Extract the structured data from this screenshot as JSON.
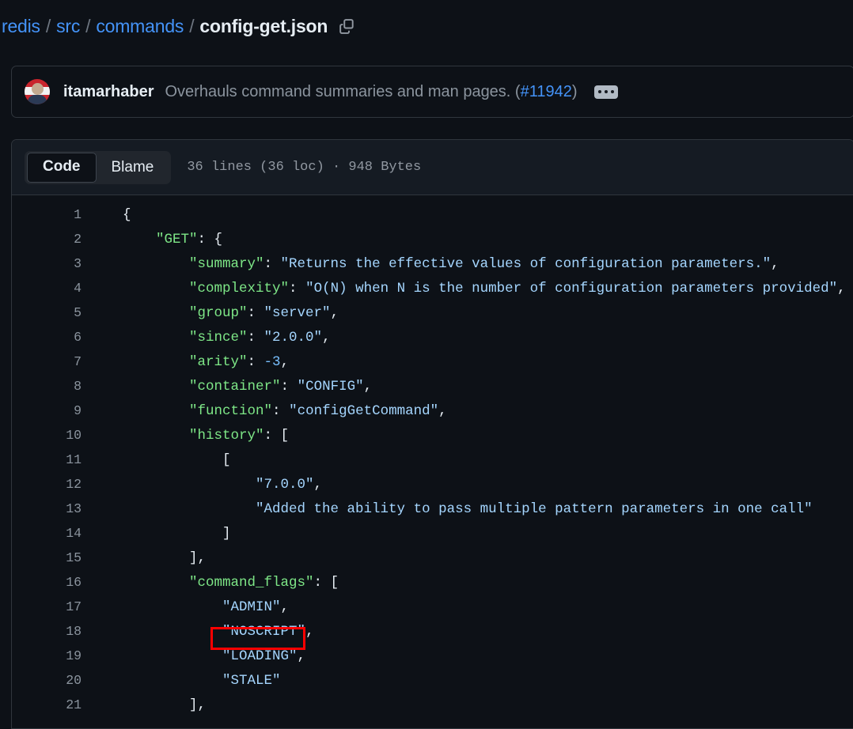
{
  "breadcrumb": {
    "repo": "redis",
    "sep": "/",
    "dir1": "src",
    "dir2": "commands",
    "file": "config-get.json",
    "copy_icon": "copy-path-icon"
  },
  "commit": {
    "author": "itamarhaber",
    "message": "Overhauls command summaries and man pages. (",
    "pr": "#11942",
    "message_end": ")",
    "menu_icon": "kebab-menu-icon"
  },
  "file_header": {
    "tab_code": "Code",
    "tab_blame": "Blame",
    "meta": "36 lines (36 loc) · 948 Bytes"
  },
  "code": {
    "lines": [
      {
        "n": "1",
        "segments": [
          {
            "t": "{",
            "c": "punct",
            "indent": 0
          }
        ]
      },
      {
        "n": "2",
        "segments": [
          {
            "t": "\"GET\"",
            "c": "key",
            "indent": 4
          },
          {
            "t": ": {",
            "c": "punct"
          }
        ]
      },
      {
        "n": "3",
        "segments": [
          {
            "t": "\"summary\"",
            "c": "key",
            "indent": 8
          },
          {
            "t": ": ",
            "c": "punct"
          },
          {
            "t": "\"Returns the effective values of configuration parameters.\"",
            "c": "str"
          },
          {
            "t": ",",
            "c": "punct"
          }
        ]
      },
      {
        "n": "4",
        "segments": [
          {
            "t": "\"complexity\"",
            "c": "key",
            "indent": 8
          },
          {
            "t": ": ",
            "c": "punct"
          },
          {
            "t": "\"O(N) when N is the number of configuration parameters provided\"",
            "c": "str"
          },
          {
            "t": ",",
            "c": "punct"
          }
        ]
      },
      {
        "n": "5",
        "segments": [
          {
            "t": "\"group\"",
            "c": "key",
            "indent": 8
          },
          {
            "t": ": ",
            "c": "punct"
          },
          {
            "t": "\"server\"",
            "c": "str"
          },
          {
            "t": ",",
            "c": "punct"
          }
        ]
      },
      {
        "n": "6",
        "segments": [
          {
            "t": "\"since\"",
            "c": "key",
            "indent": 8
          },
          {
            "t": ": ",
            "c": "punct"
          },
          {
            "t": "\"2.0.0\"",
            "c": "str"
          },
          {
            "t": ",",
            "c": "punct"
          }
        ]
      },
      {
        "n": "7",
        "segments": [
          {
            "t": "\"arity\"",
            "c": "key",
            "indent": 8
          },
          {
            "t": ": ",
            "c": "punct"
          },
          {
            "t": "-3",
            "c": "num"
          },
          {
            "t": ",",
            "c": "punct"
          }
        ]
      },
      {
        "n": "8",
        "segments": [
          {
            "t": "\"container\"",
            "c": "key",
            "indent": 8
          },
          {
            "t": ": ",
            "c": "punct"
          },
          {
            "t": "\"CONFIG\"",
            "c": "str"
          },
          {
            "t": ",",
            "c": "punct"
          }
        ]
      },
      {
        "n": "9",
        "segments": [
          {
            "t": "\"function\"",
            "c": "key",
            "indent": 8
          },
          {
            "t": ": ",
            "c": "punct"
          },
          {
            "t": "\"configGetCommand\"",
            "c": "str"
          },
          {
            "t": ",",
            "c": "punct"
          }
        ]
      },
      {
        "n": "10",
        "segments": [
          {
            "t": "\"history\"",
            "c": "key",
            "indent": 8
          },
          {
            "t": ": [",
            "c": "punct"
          }
        ]
      },
      {
        "n": "11",
        "segments": [
          {
            "t": "[",
            "c": "punct",
            "indent": 12
          }
        ]
      },
      {
        "n": "12",
        "segments": [
          {
            "t": "\"7.0.0\"",
            "c": "str",
            "indent": 16
          },
          {
            "t": ",",
            "c": "punct"
          }
        ]
      },
      {
        "n": "13",
        "segments": [
          {
            "t": "\"Added the ability to pass multiple pattern parameters in one call\"",
            "c": "str",
            "indent": 16
          }
        ]
      },
      {
        "n": "14",
        "segments": [
          {
            "t": "]",
            "c": "punct",
            "indent": 12
          }
        ]
      },
      {
        "n": "15",
        "segments": [
          {
            "t": "],",
            "c": "punct",
            "indent": 8
          }
        ]
      },
      {
        "n": "16",
        "segments": [
          {
            "t": "\"command_flags\"",
            "c": "key",
            "indent": 8
          },
          {
            "t": ": [",
            "c": "punct"
          }
        ]
      },
      {
        "n": "17",
        "segments": [
          {
            "t": "\"ADMIN\"",
            "c": "str",
            "indent": 12
          },
          {
            "t": ",",
            "c": "punct"
          }
        ]
      },
      {
        "n": "18",
        "segments": [
          {
            "t": "\"NOSCRIPT\"",
            "c": "str",
            "indent": 12
          },
          {
            "t": ",",
            "c": "punct"
          }
        ]
      },
      {
        "n": "19",
        "segments": [
          {
            "t": "\"LOADING\"",
            "c": "str",
            "indent": 12
          },
          {
            "t": ",",
            "c": "punct"
          }
        ]
      },
      {
        "n": "20",
        "segments": [
          {
            "t": "\"STALE\"",
            "c": "str",
            "indent": 12
          }
        ]
      },
      {
        "n": "21",
        "segments": [
          {
            "t": "],",
            "c": "punct",
            "indent": 8
          }
        ]
      }
    ]
  },
  "annotation": {
    "target_line": "18",
    "target_text": "\"NOSCRIPT\",",
    "color": "#ff0000"
  },
  "colors": {
    "page_bg": "#0d1117",
    "panel_header_bg": "#151b23",
    "border": "#30363d",
    "link": "#4493f8",
    "json_key": "#7ee787",
    "json_string": "#a5d6ff",
    "json_number": "#79c0ff",
    "muted": "#8b949e"
  }
}
